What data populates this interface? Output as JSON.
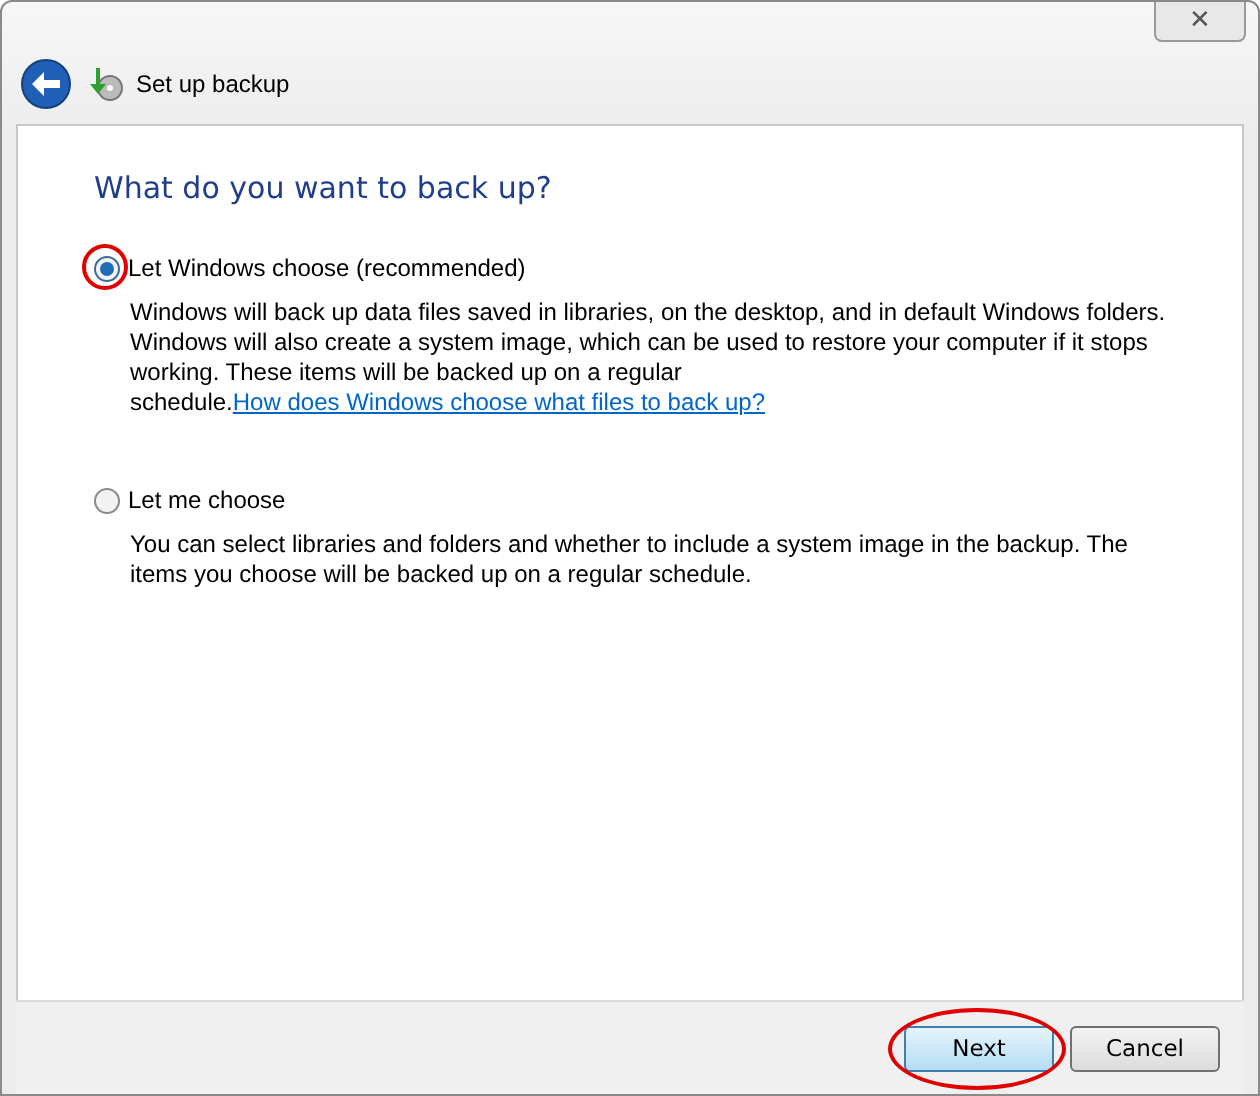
{
  "window": {
    "title": "Set up backup",
    "close": "✕"
  },
  "heading": "What do you want to back up?",
  "options": [
    {
      "label": "Let Windows choose (recommended)",
      "selected": true,
      "highlighted": true,
      "description": "Windows will back up data files saved in libraries, on the desktop, and in default Windows folders. Windows will also create a system image, which can be used to restore your computer if it stops working. These items will be backed up on a regular schedule.",
      "link": "How does Windows choose what files to back up?"
    },
    {
      "label": "Let me choose",
      "selected": false,
      "highlighted": false,
      "description": "You can select libraries and folders and whether to include a system image in the backup. The items you choose will be backed up on a regular schedule."
    }
  ],
  "buttons": [
    {
      "label": "Next",
      "kind": "primary",
      "highlighted": true
    },
    {
      "label": "Cancel",
      "kind": "normal",
      "highlighted": false
    }
  ]
}
